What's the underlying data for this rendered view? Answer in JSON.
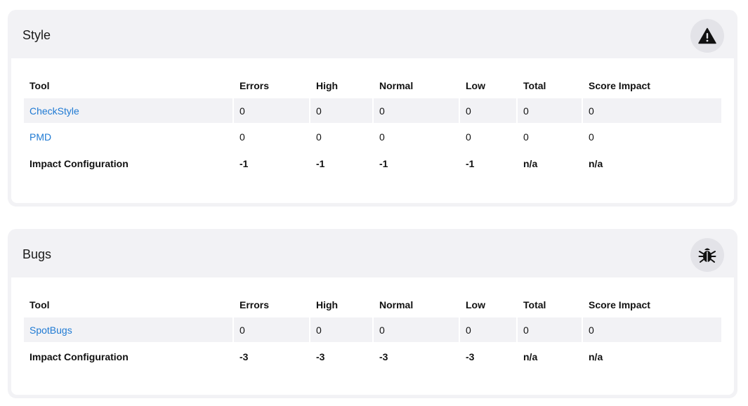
{
  "columns": [
    "Tool",
    "Errors",
    "High",
    "Normal",
    "Low",
    "Total",
    "Score Impact"
  ],
  "sections": [
    {
      "title": "Style",
      "icon": "warning-triangle-icon",
      "rows": [
        {
          "tool": "CheckStyle",
          "errors": "0",
          "high": "0",
          "normal": "0",
          "low": "0",
          "total": "0",
          "score_impact": "0"
        },
        {
          "tool": "PMD",
          "errors": "0",
          "high": "0",
          "normal": "0",
          "low": "0",
          "total": "0",
          "score_impact": "0"
        }
      ],
      "impact": {
        "label": "Impact Configuration",
        "errors": "-1",
        "high": "-1",
        "normal": "-1",
        "low": "-1",
        "total": "n/a",
        "score_impact": "n/a"
      }
    },
    {
      "title": "Bugs",
      "icon": "bug-icon",
      "rows": [
        {
          "tool": "SpotBugs",
          "errors": "0",
          "high": "0",
          "normal": "0",
          "low": "0",
          "total": "0",
          "score_impact": "0"
        }
      ],
      "impact": {
        "label": "Impact Configuration",
        "errors": "-3",
        "high": "-3",
        "normal": "-3",
        "low": "-3",
        "total": "n/a",
        "score_impact": "n/a"
      }
    }
  ],
  "colors": {
    "link": "#1f7ad3",
    "card_bg": "#f2f2f5",
    "icon_bg": "#e3e3e8"
  }
}
